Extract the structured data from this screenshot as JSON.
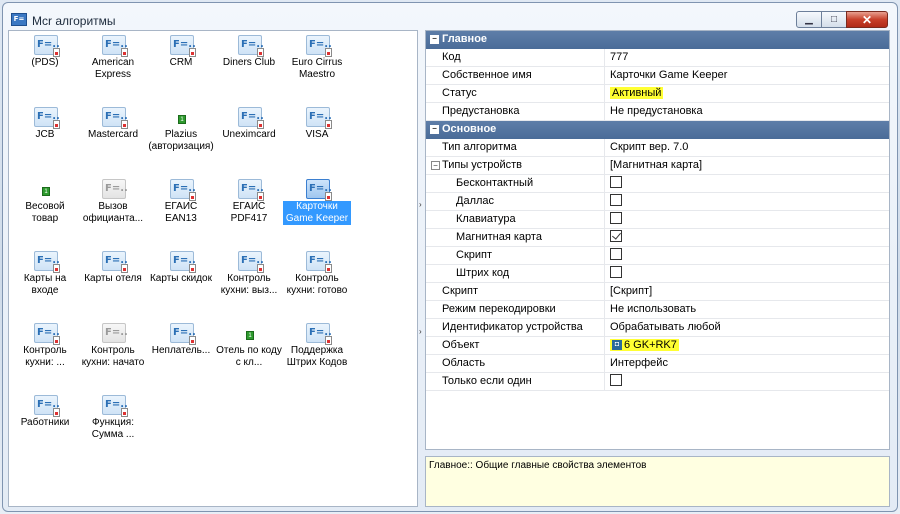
{
  "window": {
    "title": "Mcr алгоритмы"
  },
  "items": [
    {
      "label": "(PDS)",
      "icon": "f"
    },
    {
      "label": "American Express",
      "icon": "f"
    },
    {
      "label": "CRM",
      "icon": "f"
    },
    {
      "label": "Diners Club",
      "icon": "f"
    },
    {
      "label": "Euro Cirrus Maestro",
      "icon": "f"
    },
    {
      "label": "JCB",
      "icon": "f"
    },
    {
      "label": "Mastercard",
      "icon": "f"
    },
    {
      "label": "Plazius (авторизация)",
      "icon": "g"
    },
    {
      "label": "Uneximcard",
      "icon": "f"
    },
    {
      "label": "VISA",
      "icon": "f"
    },
    {
      "label": "Весовой товар",
      "icon": "g"
    },
    {
      "label": "Вызов официанта...",
      "icon": "dim"
    },
    {
      "label": "ЕГАИС EAN13",
      "icon": "f"
    },
    {
      "label": "ЕГАИС PDF417",
      "icon": "f"
    },
    {
      "label": "Карточки Game Keeper",
      "icon": "f",
      "selected": true
    },
    {
      "label": "Карты на входе",
      "icon": "f"
    },
    {
      "label": "Карты отеля",
      "icon": "f"
    },
    {
      "label": "Карты скидок",
      "icon": "f"
    },
    {
      "label": "Контроль кухни: выз...",
      "icon": "f"
    },
    {
      "label": "Контроль кухни: готово",
      "icon": "f"
    },
    {
      "label": "Контроль кухни: ...",
      "icon": "f"
    },
    {
      "label": "Контроль кухни: начато",
      "icon": "dim"
    },
    {
      "label": "Неплатель...",
      "icon": "f"
    },
    {
      "label": "Отель по коду с кл...",
      "icon": "g"
    },
    {
      "label": "Поддержка Штрих Кодов",
      "icon": "f"
    },
    {
      "label": "Работники",
      "icon": "f"
    },
    {
      "label": "Функция: Сумма ...",
      "icon": "f"
    }
  ],
  "props": {
    "cat_main": "Главное",
    "code_k": "Код",
    "code_v": "777",
    "name_k": "Собственное имя",
    "name_v": "Карточки Game Keeper",
    "status_k": "Статус",
    "status_v": "Активный",
    "preset_k": "Предустановка",
    "preset_v": "Не предустановка",
    "cat_basic": "Основное",
    "algtype_k": "Тип алгоритма",
    "algtype_v": "Скрипт вер. 7.0",
    "devtypes_k": "Типы устройств",
    "devtypes_v": "[Магнитная карта]",
    "contactless_k": "Бесконтактный",
    "contactless_checked": false,
    "dallas_k": "Даллас",
    "dallas_checked": false,
    "keyboard_k": "Клавиатура",
    "keyboard_checked": false,
    "magcard_k": "Магнитная карта",
    "magcard_checked": true,
    "script_sub_k": "Скрипт",
    "script_sub_checked": false,
    "barcode_k": "Штрих код",
    "barcode_checked": false,
    "script_k": "Скрипт",
    "script_v": "[Скрипт]",
    "recode_k": "Режим перекодировки",
    "recode_v": "Не использовать",
    "devid_k": "Идентификатор устройства",
    "devid_v": "Обрабатывать любой",
    "object_k": "Объект",
    "object_v": "6 GK+RK7",
    "area_k": "Область",
    "area_v": "Интерфейс",
    "onlyone_k": "Только если один",
    "onlyone_checked": false
  },
  "help": {
    "text": "Главное:: Общие главные свойства элементов"
  }
}
